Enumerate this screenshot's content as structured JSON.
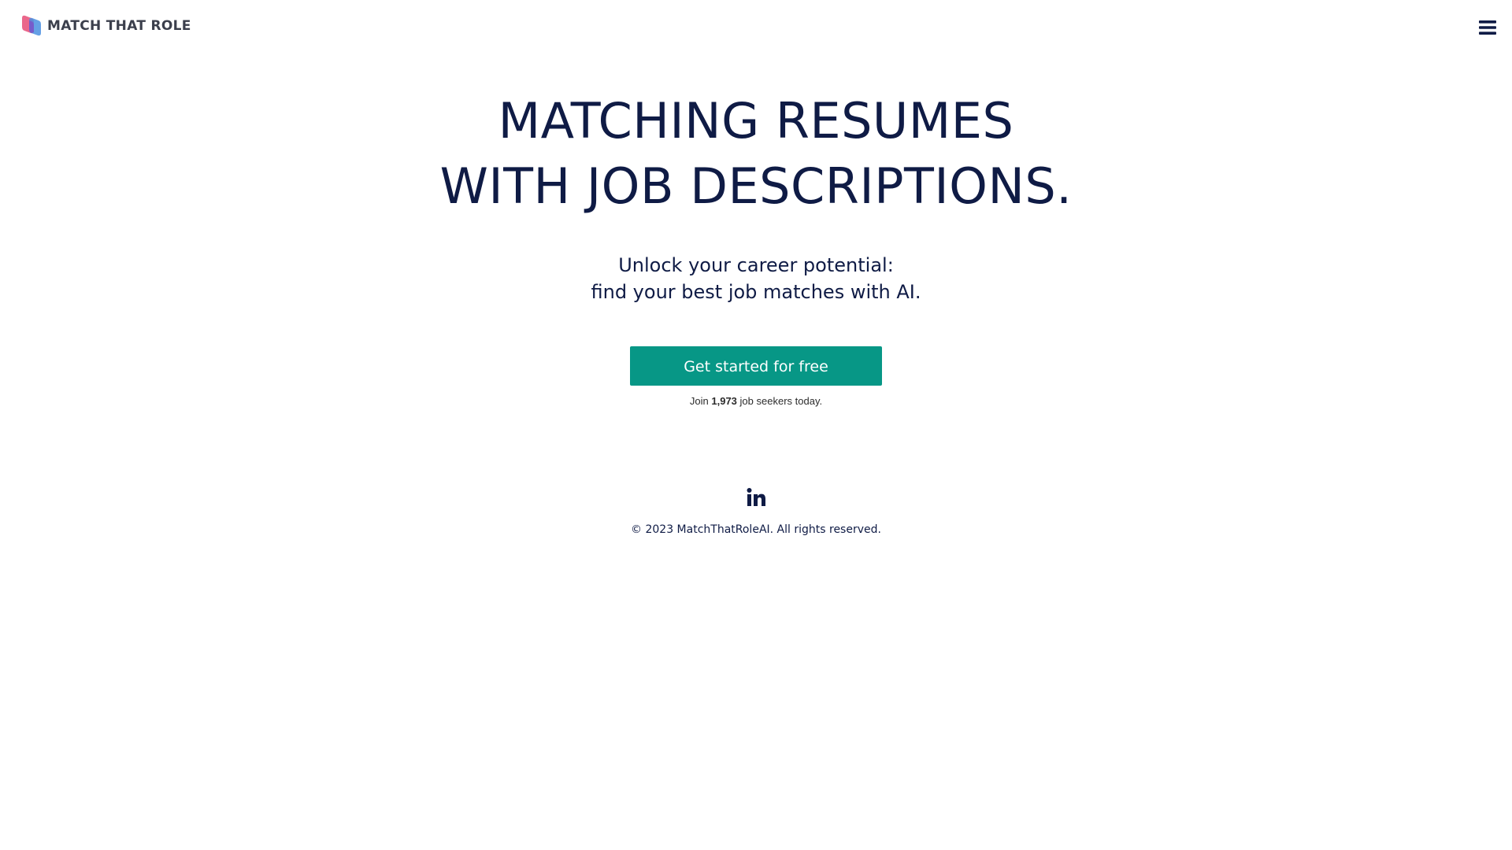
{
  "header": {
    "logo_text": "MATCH THAT ROLE",
    "logo_icon": "overlapping-shapes-logo",
    "menu_icon": "hamburger-menu-icon"
  },
  "hero": {
    "title_line1": "MATCHING RESUMES",
    "title_line2": "WITH JOB DESCRIPTIONS.",
    "subtitle_line1": "Unlock your career potential:",
    "subtitle_line2": "find your best job matches with AI.",
    "cta_label": "Get started for free",
    "join_prefix": "Join",
    "join_count": "1,973",
    "join_suffix": "job seekers today."
  },
  "footer": {
    "social_icon": "linkedin-icon",
    "copyright": "© 2023 MatchThatRoleAI. All rights reserved."
  },
  "colors": {
    "text_primary": "#0f1b45",
    "accent": "#079786",
    "logo_pink": "#e8577e",
    "logo_blue": "#4a8fe0",
    "logo_purple": "#7a56c9"
  }
}
